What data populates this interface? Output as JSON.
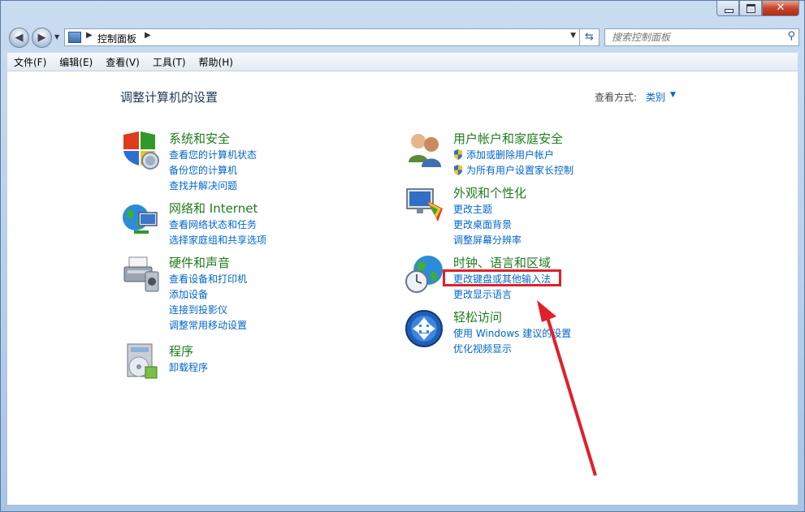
{
  "address": {
    "path": "控制面板"
  },
  "search": {
    "placeholder": "搜索控制面板"
  },
  "menu": [
    "文件(F)",
    "编辑(E)",
    "查看(V)",
    "工具(T)",
    "帮助(H)"
  ],
  "page": {
    "title": "调整计算机的设置",
    "view_label": "查看方式:",
    "view_value": "类别"
  },
  "categories": [
    {
      "title": "系统和安全",
      "links": [
        "查看您的计算机状态",
        "备份您的计算机",
        "查找并解决问题"
      ]
    },
    {
      "title": "网络和 Internet",
      "links": [
        "查看网络状态和任务",
        "选择家庭组和共享选项"
      ]
    },
    {
      "title": "硬件和声音",
      "links": [
        "查看设备和打印机",
        "添加设备",
        "连接到投影仪",
        "调整常用移动设置"
      ]
    },
    {
      "title": "程序",
      "links": [
        "卸载程序"
      ]
    },
    {
      "title": "用户帐户和家庭安全",
      "links": [
        "添加或删除用户帐户",
        "为所有用户设置家长控制"
      ]
    },
    {
      "title": "外观和个性化",
      "links": [
        "更改主题",
        "更改桌面背景",
        "调整屏幕分辨率"
      ]
    },
    {
      "title": "时钟、语言和区域",
      "links": [
        "更改键盘或其他输入法",
        "更改显示语言"
      ]
    },
    {
      "title": "轻松访问",
      "links": [
        "使用 Windows 建议的设置",
        "优化视频显示"
      ]
    }
  ],
  "annotation_color": "#e0202a",
  "icons": [
    "shield-icon",
    "network-globe-icon",
    "printer-icon",
    "programs-icon",
    "users-icon",
    "monitor-palette-icon",
    "clock-globe-icon",
    "accessibility-icon"
  ]
}
